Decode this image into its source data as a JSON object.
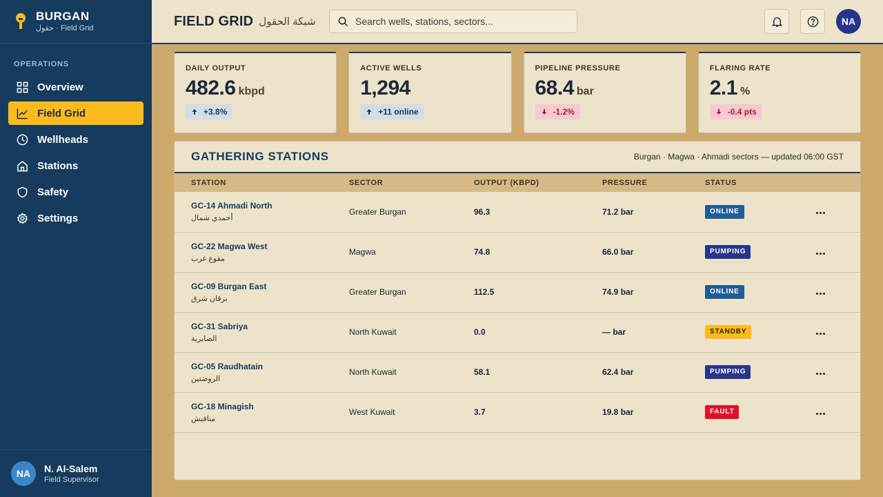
{
  "brand": {
    "name": "BURGAN",
    "subtitle": "حقول · Field Grid"
  },
  "sidebar": {
    "section": "OPERATIONS",
    "items": [
      {
        "label": "Overview",
        "icon": "grid-icon"
      },
      {
        "label": "Field Grid",
        "icon": "chart-line-icon",
        "active": true
      },
      {
        "label": "Wellheads",
        "icon": "clock-icon"
      },
      {
        "label": "Stations",
        "icon": "home-icon"
      },
      {
        "label": "Safety",
        "icon": "shield-icon"
      },
      {
        "label": "Settings",
        "icon": "gear-icon"
      }
    ]
  },
  "user": {
    "initials": "NA",
    "name": "N. Al-Salem",
    "role": "Field Supervisor"
  },
  "header": {
    "title": "FIELD GRID",
    "title_ar": "شبكة الحقول",
    "search_placeholder": "Search wells, stations, sectors...",
    "avatar_initials": "NA"
  },
  "kpis": [
    {
      "label": "DAILY OUTPUT",
      "value": "482.6",
      "unit": "kbpd",
      "delta": "+3.8%",
      "direction": "up"
    },
    {
      "label": "ACTIVE WELLS",
      "value": "1,294",
      "unit": "",
      "delta": "+11 online",
      "direction": "up"
    },
    {
      "label": "PIPELINE PRESSURE",
      "value": "68.4",
      "unit": "bar",
      "delta": "-1.2%",
      "direction": "down"
    },
    {
      "label": "FLARING RATE",
      "value": "2.1",
      "unit": "%",
      "delta": "-0.4 pts",
      "direction": "down"
    }
  ],
  "stations_panel": {
    "title": "GATHERING STATIONS",
    "meta": "Burgan · Magwa · Ahmadi sectors — updated 06:00 GST",
    "columns": [
      "STATION",
      "SECTOR",
      "OUTPUT (KBPD)",
      "PRESSURE",
      "STATUS"
    ],
    "rows": [
      {
        "name": "GC-14 Ahmadi North",
        "name_ar": "أحمدي شمال",
        "sector": "Greater Burgan",
        "output": "96.3",
        "pressure": "71.2 bar",
        "status": "ONLINE",
        "status_kind": "online"
      },
      {
        "name": "GC-22 Magwa West",
        "name_ar": "مقوع غرب",
        "sector": "Magwa",
        "output": "74.8",
        "pressure": "66.0 bar",
        "status": "PUMPING",
        "status_kind": "pumping"
      },
      {
        "name": "GC-09 Burgan East",
        "name_ar": "برقان شرق",
        "sector": "Greater Burgan",
        "output": "112.5",
        "pressure": "74.9 bar",
        "status": "ONLINE",
        "status_kind": "online"
      },
      {
        "name": "GC-31 Sabriya",
        "name_ar": "الصابرية",
        "sector": "North Kuwait",
        "output": "0.0",
        "pressure": "— bar",
        "status": "STANDBY",
        "status_kind": "standby"
      },
      {
        "name": "GC-05 Raudhatain",
        "name_ar": "الروضتين",
        "sector": "North Kuwait",
        "output": "58.1",
        "pressure": "62.4 bar",
        "status": "PUMPING",
        "status_kind": "pumping"
      },
      {
        "name": "GC-18 Minagish",
        "name_ar": "مناقيش",
        "sector": "West Kuwait",
        "output": "3.7",
        "pressure": "19.8 bar",
        "status": "FAULT",
        "status_kind": "fault"
      }
    ]
  },
  "colors": {
    "sidebar": "#163b5e",
    "accent": "#fbbb1e",
    "page_bg": "#cda96b",
    "card_bg": "#ede3cb",
    "online": "#1f5d99",
    "pumping": "#27358b",
    "standby": "#fbbb1e",
    "fault": "#e0102a"
  }
}
